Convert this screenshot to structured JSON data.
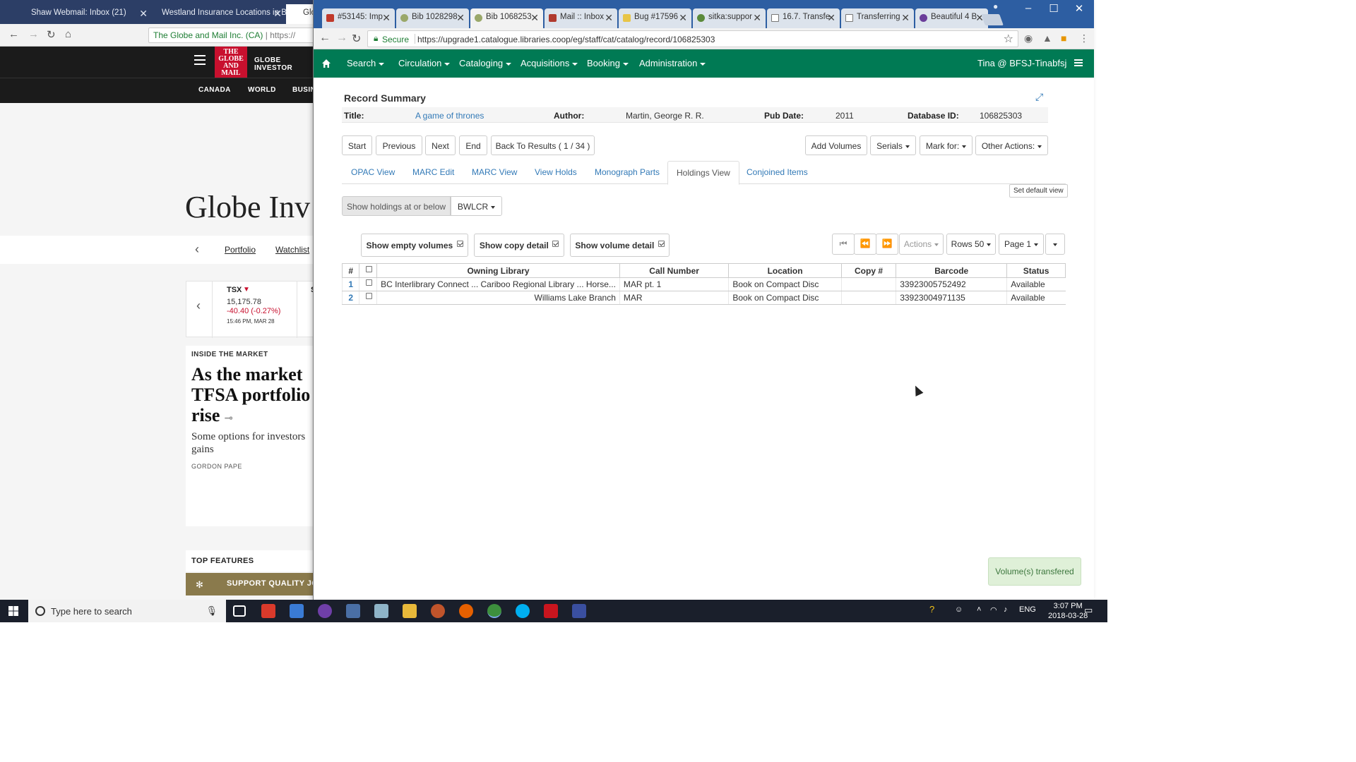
{
  "background_window": {
    "tabs": [
      {
        "label": "Shaw Webmail: Inbox (21)"
      },
      {
        "label": "Westland Insurance Locations in BC"
      },
      {
        "label": "Glo"
      }
    ],
    "omnibox": {
      "site": "The Globe and Mail Inc. (CA)",
      "url": "https://"
    },
    "page": {
      "logo": "THE GLOBE AND MAIL",
      "section": "GLOBE INVESTOR",
      "subnav": [
        "CANADA",
        "WORLD",
        "BUSIN"
      ],
      "title": "Globe Inv",
      "strip_links": [
        "Portfolio",
        "Watchlist"
      ],
      "ticker": {
        "name": "TSX",
        "value": "15,175.78",
        "change": "-40.40 (-0.27%)",
        "time": "15:46 PM, MAR 28",
        "next": "S"
      },
      "story": {
        "kicker": "INSIDE THE MARKET",
        "headline": "As the market TFSA portfolio rise",
        "dek": "Some options for investors gains",
        "byline": "GORDON PAPE"
      },
      "top_features": "TOP FEATURES",
      "support": "SUPPORT QUALITY JO"
    }
  },
  "main_window": {
    "tabs": [
      {
        "label": "#53145: Imp"
      },
      {
        "label": "Bib 1028298"
      },
      {
        "label": "Bib 1068253"
      },
      {
        "label": "Mail :: Inbox"
      },
      {
        "label": "Bug #17596"
      },
      {
        "label": "sitka:suppor"
      },
      {
        "label": "16.7. Transfe"
      },
      {
        "label": "Transferring"
      },
      {
        "label": "Beautiful 4 B"
      }
    ],
    "omnibox": {
      "secure_label": "Secure",
      "url": "https://upgrade1.catalogue.libraries.coop/eg/staff/cat/catalog/record/106825303"
    },
    "nav": {
      "items": [
        "Search",
        "Circulation",
        "Cataloging",
        "Acquisitions",
        "Booking",
        "Administration"
      ],
      "user": "Tina @ BFSJ-Tinabfsj"
    },
    "record_summary": {
      "heading": "Record Summary",
      "title_label": "Title:",
      "title_value": "A game of thrones",
      "author_label": "Author:",
      "author_value": "Martin, George R. R.",
      "pubdate_label": "Pub Date:",
      "pubdate_value": "2011",
      "dbid_label": "Database ID:",
      "dbid_value": "106825303"
    },
    "record_nav": {
      "start": "Start",
      "previous": "Previous",
      "next": "Next",
      "end": "End",
      "back": "Back To Results ( 1 / 34 )",
      "add_volumes": "Add Volumes",
      "serials": "Serials",
      "mark_for": "Mark for:",
      "other_actions": "Other Actions:"
    },
    "view_tabs": [
      "OPAC View",
      "MARC Edit",
      "MARC View",
      "View Holds",
      "Monograph Parts",
      "Holdings View",
      "Conjoined Items"
    ],
    "set_default_view": "Set default view",
    "holdings_filter": {
      "label": "Show holdings at or below",
      "org": "BWLCR"
    },
    "toggles": {
      "empty_volumes": "Show empty volumes",
      "copy_detail": "Show copy detail",
      "volume_detail": "Show volume detail"
    },
    "grid_controls": {
      "actions": "Actions",
      "rows": "Rows 50",
      "page": "Page 1"
    },
    "table": {
      "columns": [
        "#",
        "",
        "Owning Library",
        "Call Number",
        "Location",
        "Copy #",
        "Barcode",
        "Status"
      ],
      "rows": [
        {
          "num": "1",
          "owning_library": "BC Interlibrary Connect ... Cariboo Regional Library ... Horse...",
          "call_number": "MAR pt. 1",
          "location": "Book on Compact Disc",
          "copy": "",
          "barcode": "33923005752492",
          "status": "Available"
        },
        {
          "num": "2",
          "owning_library": "Williams Lake Branch",
          "call_number": "MAR",
          "location": "Book on Compact Disc",
          "copy": "",
          "barcode": "33923004971135",
          "status": "Available"
        }
      ]
    },
    "toast": "Volume(s) transfered"
  },
  "taskbar": {
    "search_placeholder": "Type here to search",
    "language": "ENG",
    "time": "3:07 PM",
    "date": "2018-03-28"
  },
  "colors": {
    "nav_green": "#007a54",
    "tabstrip_blue": "#2d5ea2",
    "link_blue": "#337ab7",
    "toast_green": "#dff0d8"
  }
}
